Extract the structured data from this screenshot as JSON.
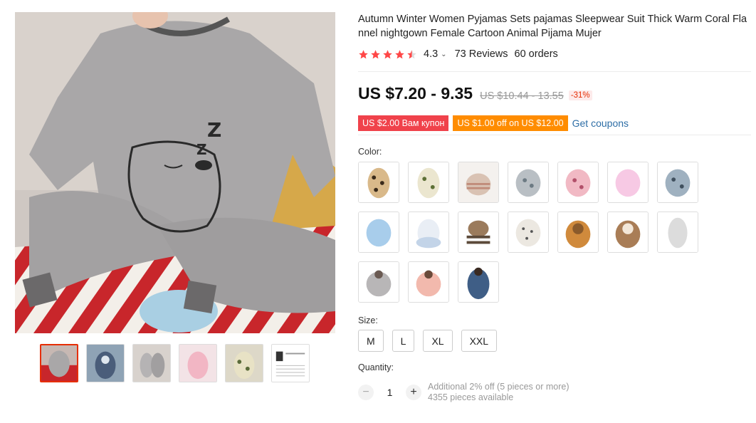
{
  "product": {
    "title": "Autumn Winter Women Pyjamas Sets pajamas Sleepwear Suit Thick Warm Coral Flannel nightgown Female Cartoon Animal Pijama Mujer",
    "rating": "4.3",
    "rating_stars": 4.3,
    "reviews": "73 Reviews",
    "orders": "60 orders"
  },
  "price": {
    "current": "US $7.20 - 9.35",
    "original": "US $10.44 - 13.55",
    "discount": "-31%"
  },
  "coupons": {
    "coupon1": "US $2.00 Вам купон",
    "coupon2": "US $1.00 off on US $12.00",
    "get_label": "Get coupons"
  },
  "color": {
    "label": "Color:",
    "swatches": [
      {
        "name": "leopard-print"
      },
      {
        "name": "cream-print"
      },
      {
        "name": "striped-beige"
      },
      {
        "name": "floral-gray"
      },
      {
        "name": "pink-pattern"
      },
      {
        "name": "light-pink"
      },
      {
        "name": "gray-blue-print"
      },
      {
        "name": "light-blue"
      },
      {
        "name": "white-blue"
      },
      {
        "name": "brown-stripe"
      },
      {
        "name": "white-dots"
      },
      {
        "name": "orange-bear"
      },
      {
        "name": "brown-bear"
      },
      {
        "name": "white-gray"
      },
      {
        "name": "gray-bear"
      },
      {
        "name": "pink-rose"
      },
      {
        "name": "navy-satin"
      }
    ]
  },
  "size": {
    "label": "Size:",
    "options": [
      "M",
      "L",
      "XL",
      "XXL"
    ]
  },
  "quantity": {
    "label": "Quantity:",
    "value": "1",
    "note1": "Additional 2% off (5 pieces or more)",
    "note2": "4355 pieces available"
  },
  "colors": {
    "accent": "#e62e04",
    "star": "#ff4747",
    "coupon_red": "#f0424b",
    "coupon_orange": "#ff8c00",
    "link": "#2e6ea6"
  }
}
